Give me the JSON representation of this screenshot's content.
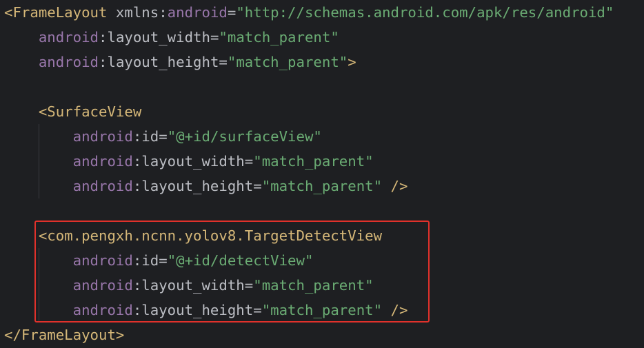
{
  "lines": [
    {
      "indent": "",
      "tokens": [
        {
          "cls": "tag",
          "text": "<FrameLayout"
        },
        {
          "cls": "plain",
          "text": " xmlns"
        },
        {
          "cls": "plain",
          "text": ":"
        },
        {
          "cls": "ns",
          "text": "android"
        },
        {
          "cls": "plain",
          "text": "="
        },
        {
          "cls": "val",
          "text": "\"http://schemas.android.com/apk/res/android\""
        }
      ]
    },
    {
      "indent": "    ",
      "tokens": [
        {
          "cls": "ns",
          "text": "android"
        },
        {
          "cls": "plain",
          "text": ":"
        },
        {
          "cls": "attr",
          "text": "layout_width"
        },
        {
          "cls": "plain",
          "text": "="
        },
        {
          "cls": "val",
          "text": "\"match_parent\""
        }
      ]
    },
    {
      "indent": "    ",
      "tokens": [
        {
          "cls": "ns",
          "text": "android"
        },
        {
          "cls": "plain",
          "text": ":"
        },
        {
          "cls": "attr",
          "text": "layout_height"
        },
        {
          "cls": "plain",
          "text": "="
        },
        {
          "cls": "val",
          "text": "\"match_parent\""
        },
        {
          "cls": "tag",
          "text": ">"
        }
      ]
    },
    {
      "indent": "",
      "tokens": []
    },
    {
      "indent": "    ",
      "tokens": [
        {
          "cls": "tag",
          "text": "<SurfaceView"
        }
      ]
    },
    {
      "indent": "        ",
      "tokens": [
        {
          "cls": "ns",
          "text": "android"
        },
        {
          "cls": "plain",
          "text": ":"
        },
        {
          "cls": "attr",
          "text": "id"
        },
        {
          "cls": "plain",
          "text": "="
        },
        {
          "cls": "val",
          "text": "\"@+id/surfaceView\""
        }
      ]
    },
    {
      "indent": "        ",
      "tokens": [
        {
          "cls": "ns",
          "text": "android"
        },
        {
          "cls": "plain",
          "text": ":"
        },
        {
          "cls": "attr",
          "text": "layout_width"
        },
        {
          "cls": "plain",
          "text": "="
        },
        {
          "cls": "val",
          "text": "\"match_parent\""
        }
      ]
    },
    {
      "indent": "        ",
      "tokens": [
        {
          "cls": "ns",
          "text": "android"
        },
        {
          "cls": "plain",
          "text": ":"
        },
        {
          "cls": "attr",
          "text": "layout_height"
        },
        {
          "cls": "plain",
          "text": "="
        },
        {
          "cls": "val",
          "text": "\"match_parent\""
        },
        {
          "cls": "plain",
          "text": " "
        },
        {
          "cls": "tag",
          "text": "/>"
        }
      ]
    },
    {
      "indent": "",
      "tokens": []
    },
    {
      "indent": "    ",
      "tokens": [
        {
          "cls": "tag",
          "text": "<com.pengxh.ncnn.yolov8.TargetDetectView"
        }
      ]
    },
    {
      "indent": "        ",
      "tokens": [
        {
          "cls": "ns",
          "text": "android"
        },
        {
          "cls": "plain",
          "text": ":"
        },
        {
          "cls": "attr",
          "text": "id"
        },
        {
          "cls": "plain",
          "text": "="
        },
        {
          "cls": "val",
          "text": "\"@+id/detectView\""
        }
      ]
    },
    {
      "indent": "        ",
      "tokens": [
        {
          "cls": "ns",
          "text": "android"
        },
        {
          "cls": "plain",
          "text": ":"
        },
        {
          "cls": "attr",
          "text": "layout_width"
        },
        {
          "cls": "plain",
          "text": "="
        },
        {
          "cls": "val",
          "text": "\"match_parent\""
        }
      ]
    },
    {
      "indent": "        ",
      "tokens": [
        {
          "cls": "ns",
          "text": "android"
        },
        {
          "cls": "plain",
          "text": ":"
        },
        {
          "cls": "attr",
          "text": "layout_height"
        },
        {
          "cls": "plain",
          "text": "="
        },
        {
          "cls": "val",
          "text": "\"match_parent\""
        },
        {
          "cls": "plain",
          "text": " "
        },
        {
          "cls": "tag",
          "text": "/>"
        }
      ]
    },
    {
      "indent": "",
      "tokens": [
        {
          "cls": "tag",
          "text": "</FrameLayout>"
        }
      ]
    }
  ],
  "colors": {
    "background": "#1e1f22",
    "tag": "#d5b778",
    "namespace": "#9876aa",
    "attribute": "#bcbec4",
    "string": "#6aab73",
    "highlight_border": "#e0312b"
  }
}
